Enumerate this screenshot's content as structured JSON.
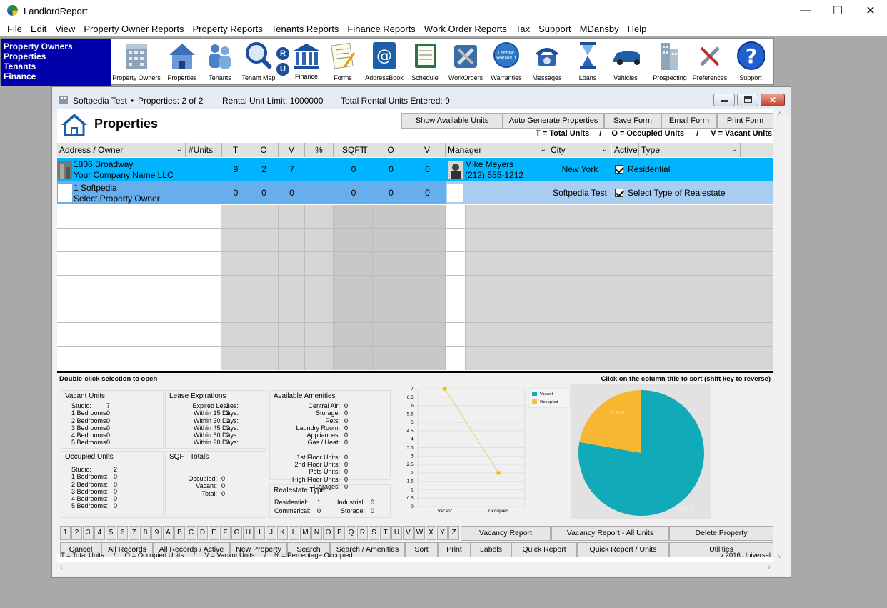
{
  "window": {
    "title": "LandlordReport"
  },
  "menu": [
    "File",
    "Edit",
    "View",
    "Property Owner Reports",
    "Property Reports",
    "Tenants Reports",
    "Finance Reports",
    "Work Order Reports",
    "Tax",
    "Support",
    "MDansby",
    "Help"
  ],
  "nav": [
    "Property Owners",
    "Properties",
    "Tenants",
    "Finance"
  ],
  "toolbar": [
    {
      "label": "Property Owners",
      "icon": "building-icon"
    },
    {
      "label": "Properties",
      "icon": "house-icon"
    },
    {
      "label": "Tenants",
      "icon": "people-icon"
    },
    {
      "label": "Tenant Map",
      "icon": "magnifier-icon"
    },
    {
      "label": "R",
      "icon": "r-badge-icon"
    },
    {
      "label": "Finance",
      "icon": "bank-icon"
    },
    {
      "label": "Forms",
      "icon": "forms-icon"
    },
    {
      "label": "AddressBook",
      "icon": "addressbook-icon"
    },
    {
      "label": "Schedule",
      "icon": "schedule-icon"
    },
    {
      "label": "WorkOrders",
      "icon": "tools-icon"
    },
    {
      "label": "Warranties",
      "icon": "warranty-icon"
    },
    {
      "label": "Messages",
      "icon": "phone-icon"
    },
    {
      "label": "Loans",
      "icon": "hourglass-icon"
    },
    {
      "label": "Vehicles",
      "icon": "car-icon"
    },
    {
      "label": "Prospecting",
      "icon": "tower-icon"
    },
    {
      "label": "Preferences",
      "icon": "wrench-icon"
    },
    {
      "label": "Support",
      "icon": "help-icon"
    }
  ],
  "ru_badge": {
    "r": "R",
    "u": "U"
  },
  "child": {
    "title_name": "Softpedia Test",
    "title_sep": "•",
    "title_props": "Properties: 2 of 2",
    "limit": "Rental Unit Limit: 1000000",
    "entered": "Total Rental Units Entered: 9",
    "heading": "Properties",
    "buttons": [
      "Show Available Units",
      "Auto Generate Properties",
      "Save Form",
      "Email Form",
      "Print Form"
    ],
    "legend_t": "T = Total Units",
    "legend_sep": "/",
    "legend_o": "O = Occupied Units",
    "legend_v": "V = Vacant Units",
    "columns": {
      "address": "Address / Owner",
      "units": "#Units:",
      "t": "T",
      "o": "O",
      "v": "V",
      "pct": "%",
      "sqft": "SQFT:",
      "st": "T",
      "so": "O",
      "sv": "V",
      "manager": "Manager",
      "city": "City",
      "active": "Active",
      "type": "Type"
    },
    "rows": [
      {
        "address": "1806 Broadway",
        "owner": "Your Company Name LLC",
        "t": "9",
        "o": "2",
        "v": "7",
        "st": "0",
        "so": "0",
        "sv": "0",
        "manager": "Mike Meyers",
        "phone": "(212) 555-1212",
        "city": "New York",
        "type": "Residential"
      },
      {
        "address": "1 Softpedia",
        "owner": "Select Property Owner",
        "t": "0",
        "o": "0",
        "v": "0",
        "st": "0",
        "so": "0",
        "sv": "0",
        "manager": "",
        "phone": "",
        "city": "Softpedia Test",
        "type": "Select Type of Realestate"
      }
    ],
    "hint_left": "Double-click selection to open",
    "hint_right": "Click on the column title to sort (shift key to reverse)",
    "vacant": {
      "title": "Vacant Units",
      "rows": [
        [
          "Studio:",
          "7"
        ],
        [
          "1 Bedrooms:",
          "0"
        ],
        [
          "2 Bedrooms:",
          "0"
        ],
        [
          "3 Bedrooms:",
          "0"
        ],
        [
          "4 Bedrooms:",
          "0"
        ],
        [
          "5 Bedrooms:",
          "0"
        ]
      ]
    },
    "occupied": {
      "title": "Occupied Units",
      "rows": [
        [
          "Studio:",
          "2"
        ],
        [
          "1 Bedrooms:",
          "0"
        ],
        [
          "2 Bedrooms:",
          "0"
        ],
        [
          "3 Bedrooms:",
          "0"
        ],
        [
          "4 Bedrooms:",
          "0"
        ],
        [
          "5 Bedrooms:",
          "0"
        ]
      ]
    },
    "lease": {
      "title": "Lease Expirations",
      "rows": [
        [
          "Expired Leases:",
          "2"
        ],
        [
          "Within 15 Days:",
          "3"
        ],
        [
          "Within 30 Days:",
          "0"
        ],
        [
          "Within 45 Days:",
          "0"
        ],
        [
          "Within 60 Days:",
          "0"
        ],
        [
          "Within 90 Days:",
          "0"
        ]
      ]
    },
    "sqft": {
      "title": "SQFT Totals",
      "rows": [
        [
          "Occupied:",
          "0"
        ],
        [
          "Vacant:",
          "0"
        ],
        [
          "Total:",
          "0"
        ]
      ]
    },
    "amen": {
      "title": "Available Amenities",
      "rows": [
        [
          "Central Air:",
          "0"
        ],
        [
          "Storage:",
          "0"
        ],
        [
          "Pets:",
          "0"
        ],
        [
          "Laundry Room:",
          "0"
        ],
        [
          "Appliances:",
          "0"
        ],
        [
          "Gas / Heat:",
          "0"
        ]
      ],
      "rows2": [
        [
          "1st Floor Units:",
          "0"
        ],
        [
          "2nd Floor Units:",
          "0"
        ],
        [
          "Pets Units:",
          "0"
        ],
        [
          "High Floor Units:",
          "0"
        ],
        [
          "Garages:",
          "0"
        ]
      ]
    },
    "retype": {
      "title": "Realestate Type",
      "residential": "Residential:",
      "res_v": "1",
      "industrial": "Industrial:",
      "ind_v": "0",
      "commercial": "Commerical:",
      "com_v": "0",
      "storage": "Storage:",
      "sto_v": "0"
    },
    "letters": [
      "1",
      "2",
      "3",
      "4",
      "5",
      "6",
      "7",
      "8",
      "9",
      "A",
      "B",
      "C",
      "D",
      "E",
      "F",
      "G",
      "H",
      "I",
      "J",
      "K",
      "L",
      "M",
      "N",
      "O",
      "P",
      "Q",
      "R",
      "S",
      "T",
      "U",
      "V",
      "W",
      "X",
      "Y",
      "Z"
    ],
    "bottom_buttons_row1": [
      "Vacancy Report",
      "Vacancy Report - All Units",
      "Delete Property"
    ],
    "bottom_buttons_row2": [
      "Cancel",
      "All Records",
      "All Records / Active",
      "New Property",
      "Search",
      "Search / Amenities",
      "Sort",
      "Print",
      "Labels",
      "Quick Report",
      "Quick Report / Units",
      "Utilities"
    ],
    "footer_legend": "T = Total Units     /     O = Occupied Units     /     V = Vacant Units     /    % = Percentage Occupied",
    "version": "v 2016 Universal"
  },
  "chart_data": [
    {
      "type": "line",
      "categories": [
        "Vacant",
        "Occupied"
      ],
      "values": [
        7,
        2
      ],
      "ylim": [
        0,
        7
      ],
      "yticks": [
        "0",
        "0.5",
        "1",
        "1.5",
        "2",
        "2.5",
        "3",
        "3.5",
        "4",
        "4.5",
        "5",
        "5.5",
        "6",
        "6.5",
        "7"
      ],
      "legend": [
        "Vacant",
        "Occupied"
      ],
      "colors": {
        "line": "#e8d65a",
        "vacant": "#1aa8b8",
        "occupied": "#f5c040"
      }
    },
    {
      "type": "pie",
      "categories": [
        "Vacant",
        "Occupied"
      ],
      "values": [
        77.77,
        22.22
      ],
      "labels": [
        "77.77 %",
        "22.22 %"
      ],
      "colors": [
        "#11aab8",
        "#f7b731"
      ]
    }
  ]
}
